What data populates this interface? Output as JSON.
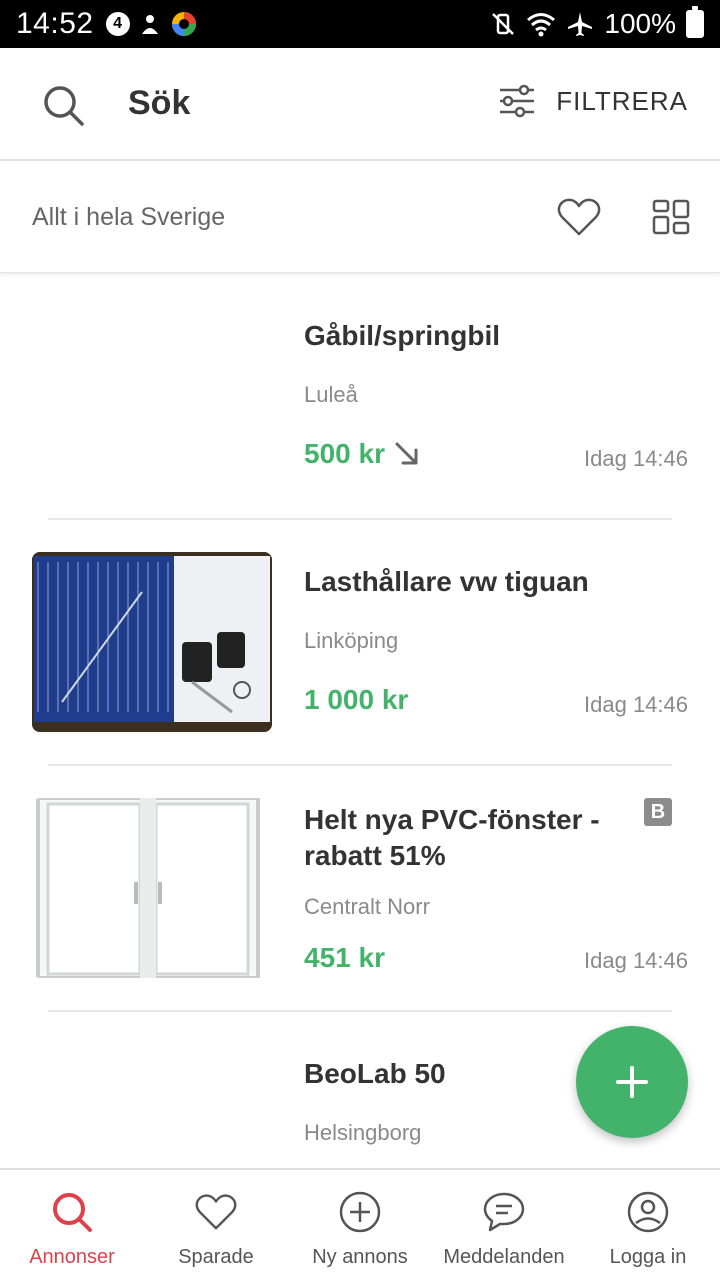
{
  "status_bar": {
    "time": "14:52",
    "badge_number": "4",
    "battery": "100%"
  },
  "header": {
    "title": "Sök",
    "filter_label": "FILTRERA"
  },
  "location_bar": {
    "text": "Allt i hela Sverige"
  },
  "listings": [
    {
      "title": "Gåbil/springbil",
      "location": "Luleå",
      "price": "500 kr",
      "price_reduced": true,
      "time": "Idag 14:46",
      "has_image": false
    },
    {
      "title": "Lasthållare vw tiguan",
      "location": "Linköping",
      "price": "1 000 kr",
      "price_reduced": false,
      "time": "Idag 14:46",
      "has_image": true
    },
    {
      "title": "Helt nya PVC-fönster - rabatt 51%",
      "location": "Centralt Norr",
      "price": "451 kr",
      "price_reduced": false,
      "time": "Idag 14:46",
      "has_image": true,
      "badge": "B"
    },
    {
      "title": "BeoLab 50",
      "location": "Helsingborg",
      "has_image": false
    }
  ],
  "bottom_nav": [
    {
      "label": "Annonser",
      "icon": "search-icon",
      "active": true
    },
    {
      "label": "Sparade",
      "icon": "heart-icon",
      "active": false
    },
    {
      "label": "Ny annons",
      "icon": "plus-circle-icon",
      "active": false
    },
    {
      "label": "Meddelanden",
      "icon": "chat-icon",
      "active": false
    },
    {
      "label": "Logga in",
      "icon": "user-icon",
      "active": false
    }
  ],
  "colors": {
    "price_green": "#43b36b",
    "active_red": "#e0404a",
    "fab_green": "#43b36b"
  }
}
